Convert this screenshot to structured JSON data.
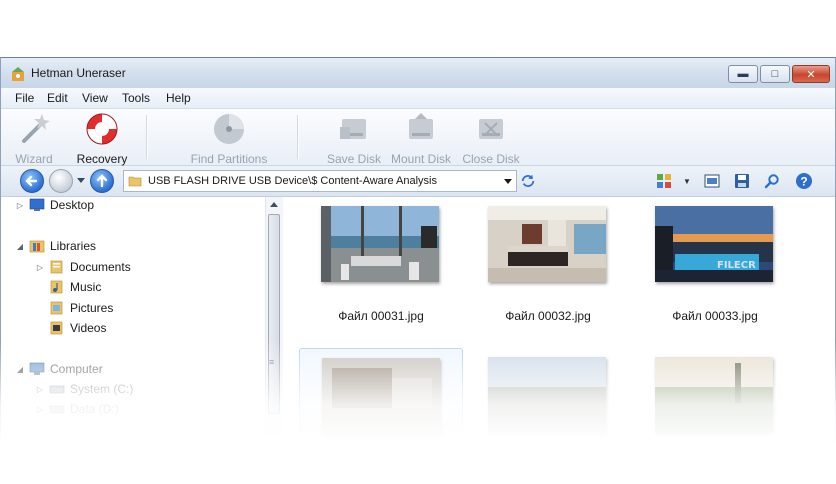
{
  "window": {
    "title": "Hetman Uneraser",
    "icon": "hetman-app-icon",
    "controls": [
      "minimize-icon",
      "maximize-icon",
      "close-icon"
    ]
  },
  "menu": [
    "File",
    "Edit",
    "View",
    "Tools",
    "Help"
  ],
  "toolbar": {
    "wizard": "Wizard",
    "recovery": "Recovery",
    "find_partitions": "Find Partitions",
    "save_disk": "Save Disk",
    "mount_disk": "Mount Disk",
    "close_disk": "Close Disk"
  },
  "address": {
    "path": "USB FLASH DRIVE USB Device\\$ Content-Aware Analysis"
  },
  "tree": {
    "desktop": "Desktop",
    "libraries": "Libraries",
    "documents": "Documents",
    "music": "Music",
    "pictures": "Pictures",
    "videos": "Videos",
    "computer": "Computer",
    "system_c": "System (C:)",
    "data_d": "Data (D:)"
  },
  "files": [
    {
      "name": "Файл 00031.jpg"
    },
    {
      "name": "Файл 00032.jpg"
    },
    {
      "name": "Файл 00033.jpg",
      "watermark": "FILECR"
    },
    {
      "name": ""
    },
    {
      "name": ""
    },
    {
      "name": ""
    }
  ],
  "colors": {
    "accent_blue": "#2c6fd0",
    "titlebar": "#d2deed",
    "selection": "#b3d3f2"
  }
}
